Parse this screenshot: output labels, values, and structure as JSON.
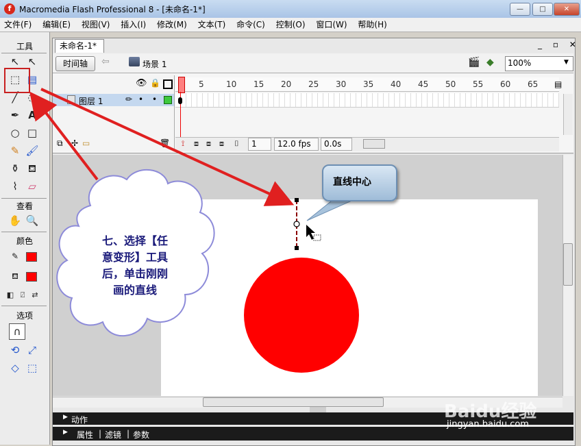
{
  "window": {
    "app_icon_letter": "f",
    "title": "Macromedia Flash Professional 8 - [未命名-1*]",
    "minimize": "—",
    "maximize": "□",
    "close": "✕"
  },
  "menu": [
    "文件(F)",
    "编辑(E)",
    "视图(V)",
    "插入(I)",
    "修改(M)",
    "文本(T)",
    "命令(C)",
    "控制(O)",
    "窗口(W)",
    "帮助(H)"
  ],
  "tools": {
    "header": "工具",
    "view_header": "查看",
    "color_header": "颜色",
    "options_header": "选项"
  },
  "document": {
    "tab_label": "未命名-1*",
    "timeline_button": "时间轴",
    "scene_label": "场景 1",
    "zoom": "100%"
  },
  "timeline": {
    "frame_numbers": [
      "1",
      "5",
      "10",
      "15",
      "20",
      "25",
      "30",
      "35",
      "40",
      "45",
      "50",
      "55",
      "60",
      "65"
    ],
    "layer_name": "图层 1",
    "current_frame": "1",
    "fps": "12.0 fps",
    "time": "0.0s"
  },
  "panels": {
    "actions": "动作",
    "properties": "属性",
    "filters": "滤镜",
    "parameters": "参数"
  },
  "annotations": {
    "callout": "直线中心",
    "cloud_lines": [
      "七、选择【任",
      "意变形】工具",
      "后，单击刚刚",
      "画的直线"
    ]
  },
  "watermark": {
    "brand": "Baidu经验",
    "url": "jingyan.baidu.com"
  },
  "colors": {
    "fill": "#ff0000",
    "stroke": "#c00000",
    "arrow": "#e02020"
  }
}
